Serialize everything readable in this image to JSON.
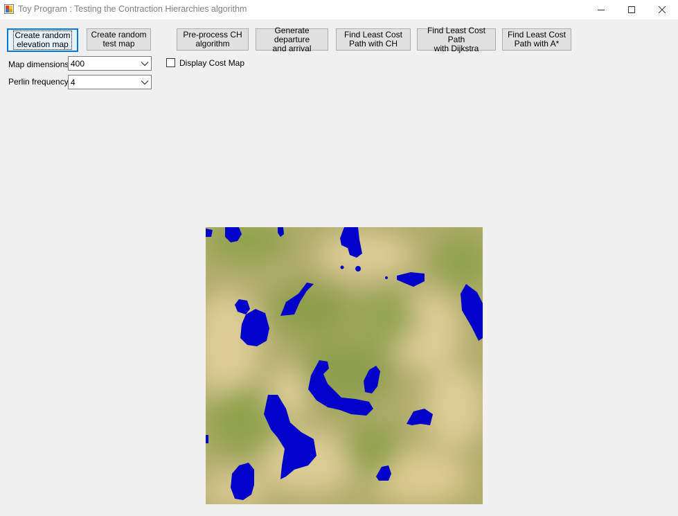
{
  "window": {
    "title": "Toy Program : Testing the Contraction Hierarchies algorithm",
    "icon": "app-form-icon",
    "controls": [
      "minimize-icon",
      "maximize-icon",
      "close-icon"
    ]
  },
  "buttons": {
    "create_elevation": "Create random\nelevation map",
    "create_test": "Create random\ntest map",
    "preprocess_ch": "Pre-process CH\nalgorithm",
    "generate_departure": "Generate departure\nand arrival",
    "find_ch": "Find Least Cost\nPath with CH",
    "find_dijkstra": "Find Least Cost Path\nwith Dijkstra",
    "find_astar": "Find Least Cost\nPath with A*"
  },
  "settings": {
    "map_dimensions_label": "Map dimensions",
    "map_dimensions_value": "400",
    "perlin_frequency_label": "Perlin frequency",
    "perlin_frequency_value": "4",
    "display_cost_map_label": "Display Cost Map",
    "display_cost_map_checked": false
  },
  "colors": {
    "water": "#0000c8",
    "land_green": "#8fa24c",
    "land_sand": "#dccb94",
    "accent": "#0078d7"
  }
}
